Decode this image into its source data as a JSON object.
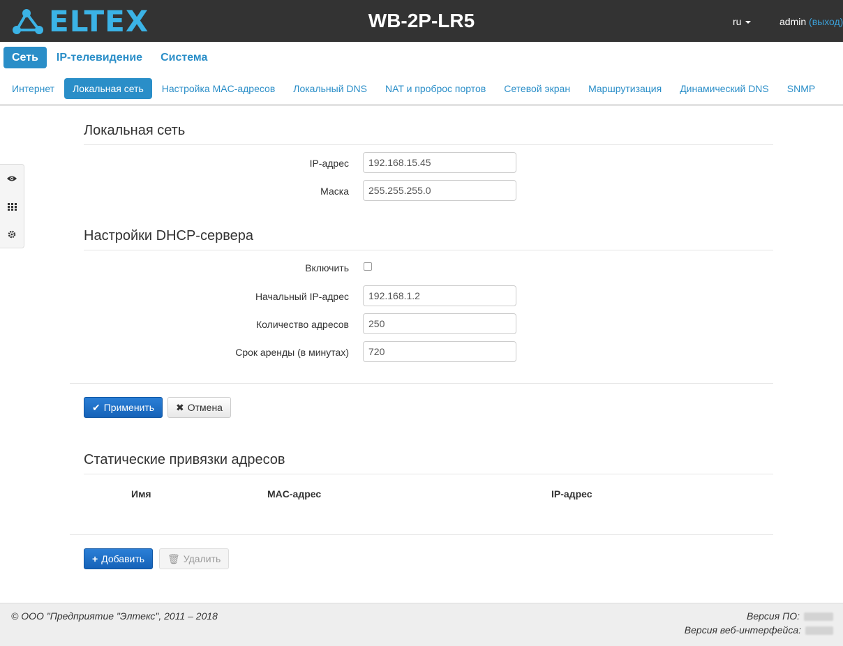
{
  "header": {
    "logo_text": "ELTEX",
    "device_name": "WB-2P-LR5",
    "language": "ru",
    "user": "admin",
    "logout": "(выход)"
  },
  "main_nav": [
    {
      "label": "Сеть",
      "active": true
    },
    {
      "label": "IP-телевидение",
      "active": false
    },
    {
      "label": "Система",
      "active": false
    }
  ],
  "sub_nav": [
    {
      "label": "Интернет",
      "active": false
    },
    {
      "label": "Локальная сеть",
      "active": true
    },
    {
      "label": "Настройка MAC-адресов",
      "active": false
    },
    {
      "label": "Локальный DNS",
      "active": false
    },
    {
      "label": "NAT и проброс портов",
      "active": false
    },
    {
      "label": "Сетевой экран",
      "active": false
    },
    {
      "label": "Маршрутизация",
      "active": false
    },
    {
      "label": "Динамический DNS",
      "active": false
    },
    {
      "label": "SNMP",
      "active": false
    }
  ],
  "side_tools": [
    "eye-icon",
    "grid-icon",
    "gear-icon"
  ],
  "lan": {
    "title": "Локальная сеть",
    "ip_label": "IP-адрес",
    "ip_value": "192.168.15.45",
    "mask_label": "Маска",
    "mask_value": "255.255.255.0"
  },
  "dhcp": {
    "title": "Настройки DHCP-сервера",
    "enable_label": "Включить",
    "enabled": false,
    "start_ip_label": "Начальный IP-адрес",
    "start_ip_value": "192.168.1.2",
    "count_label": "Количество адресов",
    "count_value": "250",
    "lease_label": "Срок аренды (в минутах)",
    "lease_value": "720"
  },
  "actions": {
    "apply": "Применить",
    "cancel": "Отмена"
  },
  "static": {
    "title": "Статические привязки адресов",
    "columns": [
      "Имя",
      "MAC-адрес",
      "IP-адрес"
    ],
    "add": "Добавить",
    "delete": "Удалить"
  },
  "footer": {
    "copyright": "© ООО \"Предприятие \"Элтекс\", 2011 – 2018",
    "fw_label": "Версия ПО:",
    "web_label": "Версия веб-интерфейса:"
  },
  "colors": {
    "header_bg": "#333333",
    "accent": "#2a8ec8",
    "logo": "#3bb3e6",
    "primary_button": "#1d6fc7"
  }
}
